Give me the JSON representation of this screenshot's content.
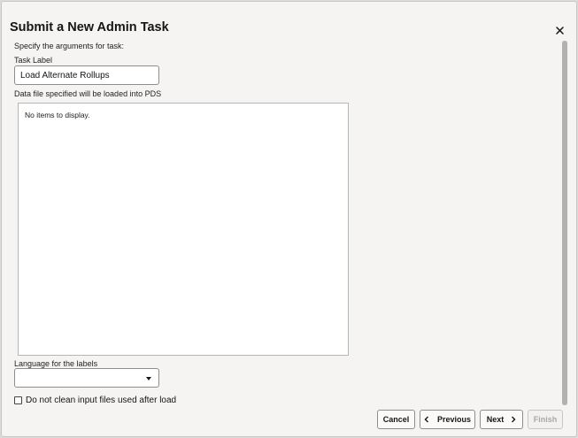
{
  "dialog": {
    "title": "Submit a New Admin Task",
    "close_icon": "close-icon",
    "subtitle": "Specify the arguments for task:"
  },
  "task_label": {
    "label": "Task Label",
    "value": "Load Alternate Rollups"
  },
  "data_file": {
    "label": "Data file specified will be loaded into PDS",
    "empty_message": "No items to display."
  },
  "language": {
    "label": "Language for the labels",
    "selected": "",
    "icon": "chevron-down-icon"
  },
  "options": {
    "no_clean_label": "Do not clean input files used after load",
    "no_clean_checked": false
  },
  "footer": {
    "cancel_label": "Cancel",
    "previous_label": "Previous",
    "next_label": "Next",
    "finish_label": "Finish"
  }
}
